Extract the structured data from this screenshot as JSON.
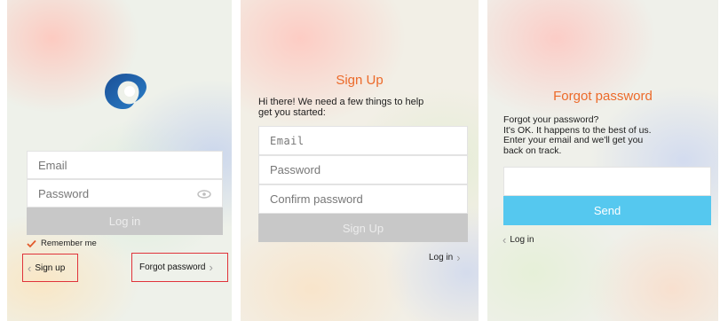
{
  "login": {
    "email_placeholder": "Email",
    "password_placeholder": "Password",
    "login_button": "Log in",
    "remember_me": "Remember me",
    "sign_up_link": "Sign up",
    "forgot_password_link": "Forgot password"
  },
  "signup": {
    "title": "Sign Up",
    "intro_line1": "Hi there! We need a few things to help",
    "intro_line2": "get you started:",
    "email_placeholder": "Email",
    "password_placeholder": "Password",
    "confirm_password_placeholder": "Confirm password",
    "signup_button": "Sign Up",
    "login_link": "Log in"
  },
  "forgot": {
    "title": "Forgot password",
    "line1": "Forgot your password?",
    "line2": "It's OK. It happens to the best of us.",
    "line3": "Enter your email and we'll get you",
    "line4": "back on track.",
    "send_button": "Send",
    "login_link": "Log in"
  },
  "colors": {
    "accent_orange": "#ec6a2a",
    "send_blue": "#55c8ef",
    "highlight_red": "#e0333a",
    "logo_blue": "#1f5fa8"
  }
}
